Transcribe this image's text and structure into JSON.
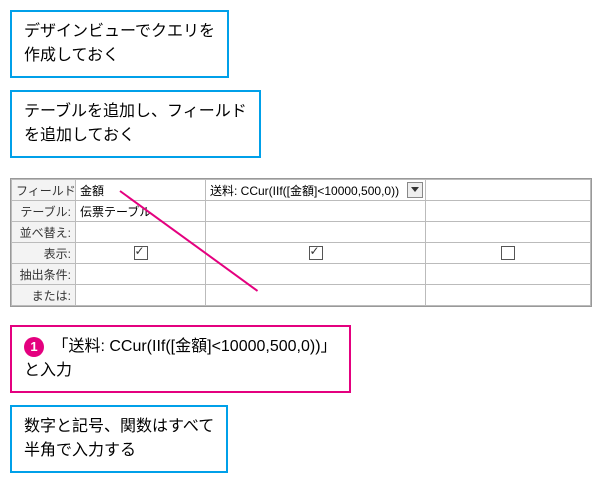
{
  "callouts": {
    "c1_l1": "デザインビューでクエリを",
    "c1_l2": "作成しておく",
    "c2_l1": "テーブルを追加し、フィールド",
    "c2_l2": "を追加しておく",
    "c3_num": "1",
    "c3_text1": "「送料: CCur(IIf([金額]<10000,500,0))」",
    "c3_text2": "と入力",
    "c4_l1": "数字と記号、関数はすべて",
    "c4_l2": "半角で入力する"
  },
  "grid": {
    "rows": {
      "field": "フィールド:",
      "table": "テーブル:",
      "sort": "並べ替え:",
      "show": "表示:",
      "criteria": "抽出条件:",
      "or": "または:"
    },
    "col1_field": "金額",
    "col1_table": "伝票テーブル",
    "col2_field": "送料: CCur(IIf([金額]<10000,500,0))"
  }
}
